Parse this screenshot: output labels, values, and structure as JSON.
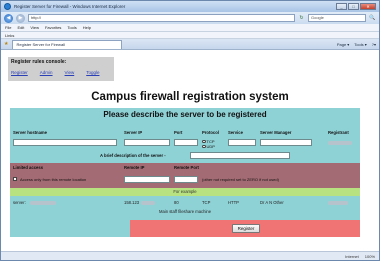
{
  "window": {
    "title": "Register Server for Firewall - Windows Internet Explorer",
    "controls": {
      "minimize": "_",
      "maximize": "□",
      "close": "✕"
    }
  },
  "addressbar": {
    "back": "◀",
    "forward": "▶",
    "url": "http://",
    "refresh": "↻",
    "search_placeholder": "Google",
    "search_icon": "🔍"
  },
  "menu": [
    "File",
    "Edit",
    "View",
    "Favorites",
    "Tools",
    "Help"
  ],
  "favorites_bar": {
    "label": "Links"
  },
  "tab": {
    "label": "Register Server for Firewall"
  },
  "commands": [
    "Page ▾",
    "Tools ▾",
    "?▾"
  ],
  "rules": {
    "title": "Register rules console:",
    "links": [
      "Register",
      "Admin",
      "View",
      "Toggle"
    ]
  },
  "heading": "Campus firewall registration system",
  "form": {
    "header": "Please describe the server to be registered",
    "columns": {
      "hostname": "Server hostname",
      "ip": "Server IP",
      "port": "Port",
      "protocol": "Protocol",
      "service": "Service",
      "manager": "Server Manager",
      "registrant": "Registrant"
    },
    "protocol_options": [
      "TCP",
      "UDP"
    ],
    "description_label": "A brief description of the server -",
    "limited": {
      "title": "Limited access",
      "remote_ip": "Remote IP",
      "remote_port": "Remote Port",
      "checkbox_label": "Access only from this remote location",
      "note": "(other not required set to ZERO if not used)"
    },
    "example_label": "For example",
    "example": {
      "server_label": "server:",
      "ip": "158.123",
      "port": "80",
      "protocol": "TCP",
      "service": "HTTP",
      "manager": "Dr A N Other",
      "description": "Main staff fileshare machine"
    },
    "register_button": "Register"
  },
  "status": {
    "zone": "Internet",
    "zoom": "100%"
  },
  "colors": {
    "form_bg": "#8fd2d6",
    "limited_bg": "#a36b73",
    "example_bg": "#b7e27f",
    "register_bg": "#f07474",
    "rules_bg": "#cfcfcf"
  }
}
